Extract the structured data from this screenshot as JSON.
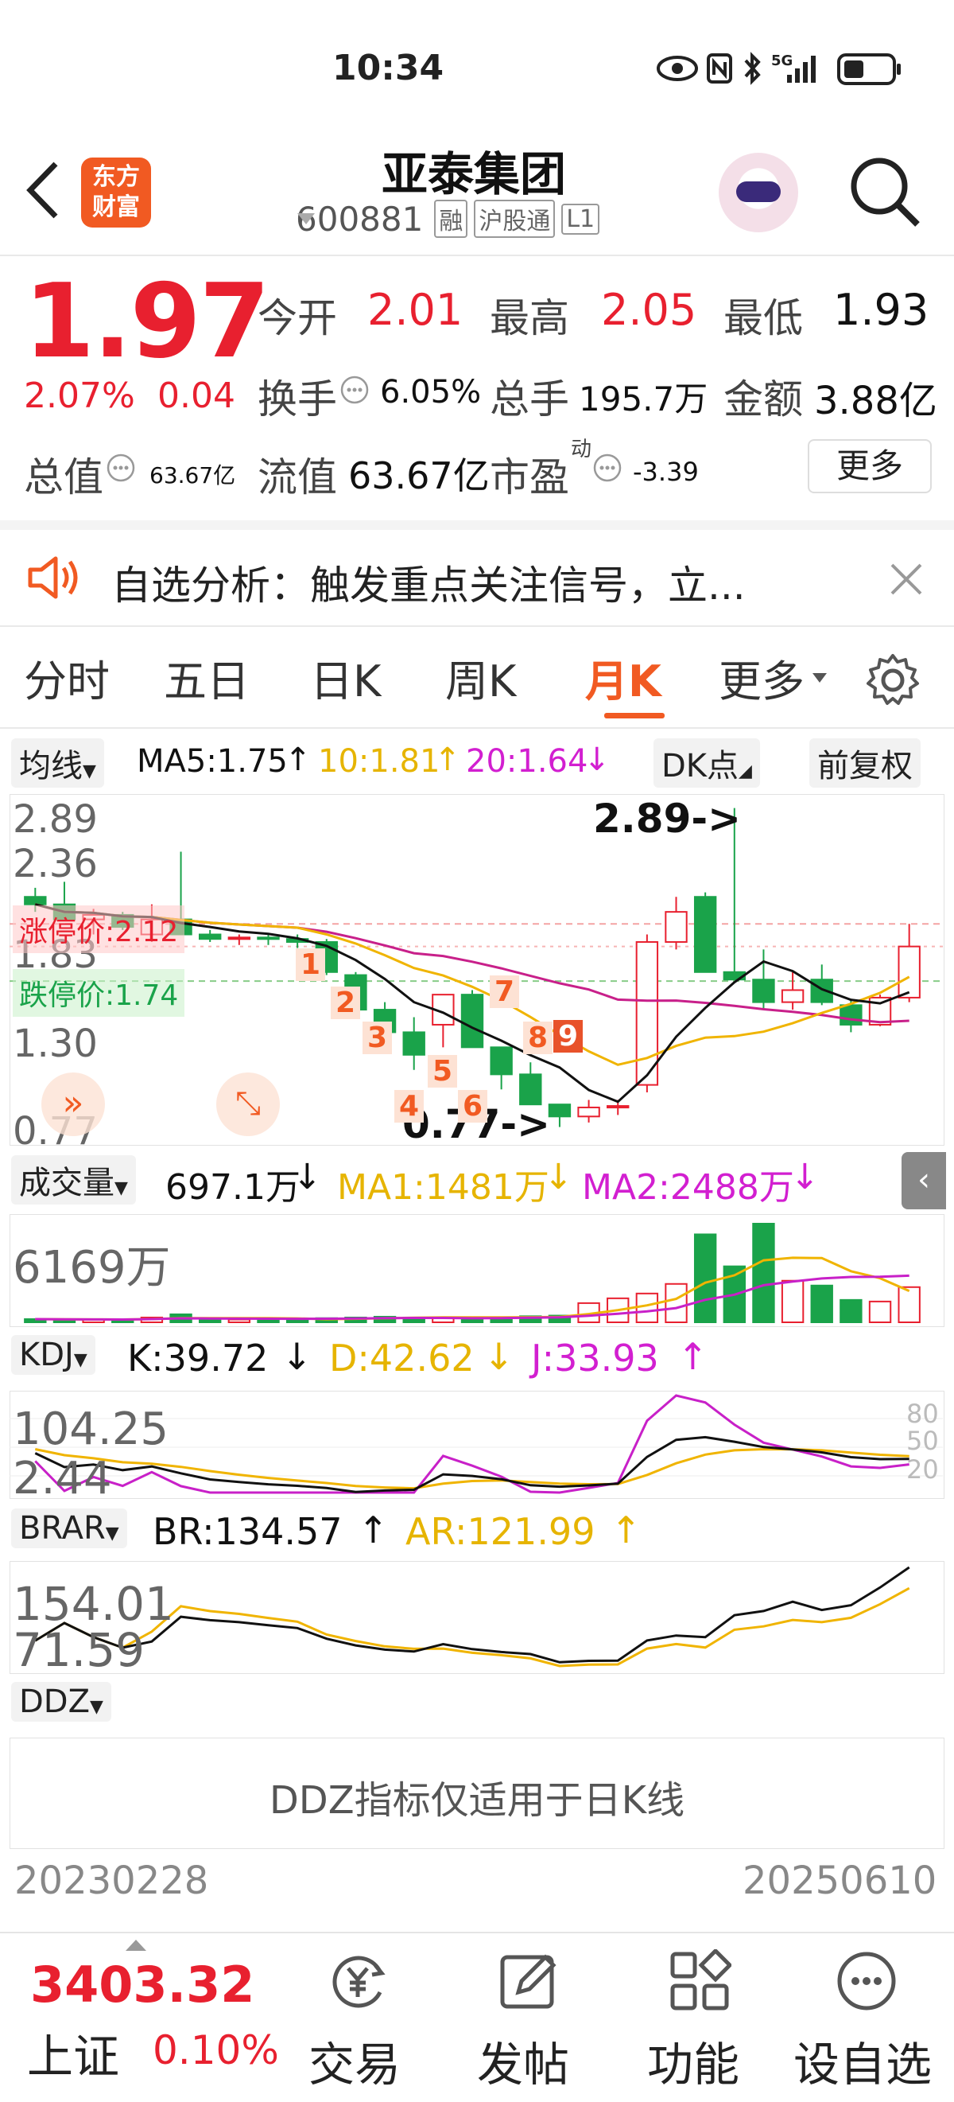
{
  "status_bar": {
    "time": "10:34",
    "signal": "5G"
  },
  "header": {
    "stock_name": "亚泰集团",
    "code": "600881",
    "tags": [
      "融",
      "沪股通",
      "L1"
    ],
    "logo_text": "东方\n财富"
  },
  "quote": {
    "price": "1.97",
    "pct": "2.07%",
    "chg": "0.04",
    "open_label": "今开",
    "open": "2.01",
    "high_label": "最高",
    "high": "2.05",
    "low_label": "最低",
    "low": "1.93",
    "turnover_label": "换手",
    "turnover": "6.05%",
    "vol_label": "总手",
    "vol": "195.7万",
    "amount_label": "金额",
    "amount": "3.88亿",
    "mktcap_label": "总值",
    "mktcap": "63.67亿",
    "float_label": "流值",
    "float": "63.67亿",
    "pe_label": "市盈",
    "pe_sup": "动",
    "pe": "-3.39",
    "more": "更多"
  },
  "banner": {
    "text": "自选分析：触发重点关注信号，立..."
  },
  "tabs": [
    "分时",
    "五日",
    "日K",
    "周K",
    "月K",
    "更多"
  ],
  "active_tab": "月K",
  "ma_row": {
    "dropdown": "均线",
    "ma5": "MA5:1.75",
    "ma10": "10:1.81",
    "ma20": "20:1.64",
    "dk": "DK点",
    "fq": "前复权"
  },
  "kchart": {
    "axis": [
      "2.89",
      "2.36",
      "1.83",
      "1.30",
      "0.77"
    ],
    "limit_up": "涨停价:2.12",
    "limit_down": "跌停价:1.74",
    "high_mark": "2.89->",
    "low_mark": "0.77->",
    "seq_nums": [
      "1",
      "2",
      "3",
      "4",
      "5",
      "6",
      "7",
      "8",
      "9"
    ]
  },
  "volume": {
    "dropdown": "成交量",
    "val": "697.1万",
    "ma1": "MA1:1481万",
    "ma2": "MA2:2488万",
    "axis_max": "6169万"
  },
  "kdj": {
    "dropdown": "KDJ",
    "k": "K:39.72",
    "d": "D:42.62",
    "j": "J:33.93",
    "axis_top": "104.25",
    "axis_bot": "2.44",
    "r80": "80",
    "r50": "50",
    "r20": "20"
  },
  "brar": {
    "dropdown": "BRAR",
    "br": "BR:134.57",
    "ar": "AR:121.99",
    "axis_top": "154.01",
    "axis_bot": "71.59"
  },
  "ddz": {
    "dropdown": "DDZ",
    "note": "DDZ指标仅适用于日K线"
  },
  "dates": {
    "start": "20230228",
    "end": "20250610"
  },
  "bottom_nav": {
    "index_value": "3403.32",
    "index_name": "上证",
    "index_pct": "0.10%",
    "trade": "交易",
    "post": "发帖",
    "func": "功能",
    "watch": "设自选"
  },
  "chart_data": {
    "type": "candlestick",
    "note_units": "price CNY",
    "ohlc": [
      [
        2.3,
        2.36,
        2.2,
        2.25
      ],
      [
        2.25,
        2.4,
        2.15,
        2.15
      ],
      [
        2.15,
        2.22,
        2.05,
        2.18
      ],
      [
        2.18,
        2.2,
        2.08,
        2.1
      ],
      [
        2.05,
        2.25,
        2.0,
        2.15
      ],
      [
        2.15,
        2.6,
        2.05,
        2.05
      ],
      [
        2.05,
        2.08,
        2.0,
        2.02
      ],
      [
        2.02,
        2.05,
        1.98,
        2.03
      ],
      [
        2.03,
        2.05,
        1.98,
        2.02
      ],
      [
        2.02,
        2.05,
        1.96,
        2.0
      ],
      [
        2.0,
        2.02,
        1.78,
        1.8
      ],
      [
        1.78,
        1.8,
        1.6,
        1.55
      ],
      [
        1.55,
        1.6,
        1.3,
        1.4
      ],
      [
        1.4,
        1.5,
        1.15,
        1.25
      ],
      [
        1.45,
        1.65,
        1.3,
        1.65
      ],
      [
        1.65,
        1.68,
        1.32,
        1.3
      ],
      [
        1.3,
        1.3,
        1.02,
        1.12
      ],
      [
        1.12,
        1.2,
        0.95,
        0.92
      ],
      [
        0.92,
        0.92,
        0.77,
        0.84
      ],
      [
        0.84,
        0.95,
        0.8,
        0.9
      ],
      [
        0.9,
        0.95,
        0.85,
        0.91
      ],
      [
        1.05,
        2.05,
        1.0,
        2.0
      ],
      [
        2.0,
        2.3,
        1.95,
        2.2
      ],
      [
        2.3,
        2.33,
        1.8,
        1.8
      ],
      [
        1.8,
        2.89,
        1.75,
        1.75
      ],
      [
        1.75,
        1.95,
        1.55,
        1.6
      ],
      [
        1.6,
        1.8,
        1.55,
        1.68
      ],
      [
        1.75,
        1.85,
        1.58,
        1.6
      ],
      [
        1.58,
        1.62,
        1.4,
        1.45
      ],
      [
        1.45,
        1.65,
        1.44,
        1.63
      ],
      [
        1.63,
        2.12,
        1.6,
        1.97
      ]
    ],
    "volume": [
      200,
      180,
      150,
      160,
      300,
      500,
      180,
      170,
      160,
      200,
      260,
      300,
      350,
      300,
      320,
      280,
      300,
      380,
      420,
      1200,
      1500,
      1800,
      2400,
      5500,
      3500,
      6169,
      2600,
      2300,
      1400,
      1300,
      2200
    ]
  }
}
